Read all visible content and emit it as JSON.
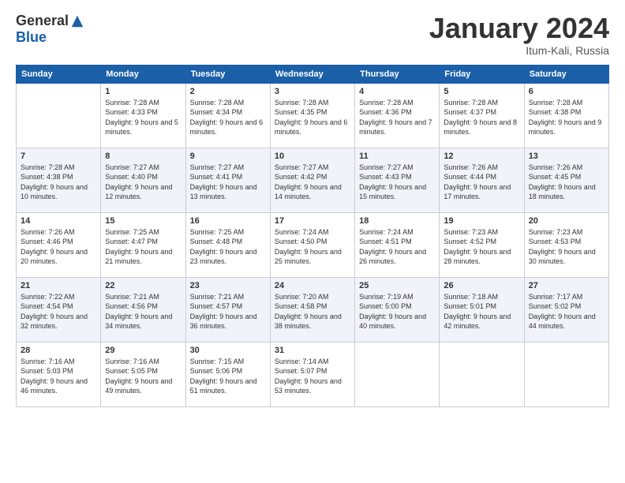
{
  "logo": {
    "general": "General",
    "blue": "Blue"
  },
  "title": "January 2024",
  "location": "Itum-Kali, Russia",
  "days_of_week": [
    "Sunday",
    "Monday",
    "Tuesday",
    "Wednesday",
    "Thursday",
    "Friday",
    "Saturday"
  ],
  "weeks": [
    [
      {
        "day": "",
        "sunrise": "",
        "sunset": "",
        "daylight": ""
      },
      {
        "day": "1",
        "sunrise": "Sunrise: 7:28 AM",
        "sunset": "Sunset: 4:33 PM",
        "daylight": "Daylight: 9 hours and 5 minutes."
      },
      {
        "day": "2",
        "sunrise": "Sunrise: 7:28 AM",
        "sunset": "Sunset: 4:34 PM",
        "daylight": "Daylight: 9 hours and 6 minutes."
      },
      {
        "day": "3",
        "sunrise": "Sunrise: 7:28 AM",
        "sunset": "Sunset: 4:35 PM",
        "daylight": "Daylight: 9 hours and 6 minutes."
      },
      {
        "day": "4",
        "sunrise": "Sunrise: 7:28 AM",
        "sunset": "Sunset: 4:36 PM",
        "daylight": "Daylight: 9 hours and 7 minutes."
      },
      {
        "day": "5",
        "sunrise": "Sunrise: 7:28 AM",
        "sunset": "Sunset: 4:37 PM",
        "daylight": "Daylight: 9 hours and 8 minutes."
      },
      {
        "day": "6",
        "sunrise": "Sunrise: 7:28 AM",
        "sunset": "Sunset: 4:38 PM",
        "daylight": "Daylight: 9 hours and 9 minutes."
      }
    ],
    [
      {
        "day": "7",
        "sunrise": "Sunrise: 7:28 AM",
        "sunset": "Sunset: 4:38 PM",
        "daylight": "Daylight: 9 hours and 10 minutes."
      },
      {
        "day": "8",
        "sunrise": "Sunrise: 7:27 AM",
        "sunset": "Sunset: 4:40 PM",
        "daylight": "Daylight: 9 hours and 12 minutes."
      },
      {
        "day": "9",
        "sunrise": "Sunrise: 7:27 AM",
        "sunset": "Sunset: 4:41 PM",
        "daylight": "Daylight: 9 hours and 13 minutes."
      },
      {
        "day": "10",
        "sunrise": "Sunrise: 7:27 AM",
        "sunset": "Sunset: 4:42 PM",
        "daylight": "Daylight: 9 hours and 14 minutes."
      },
      {
        "day": "11",
        "sunrise": "Sunrise: 7:27 AM",
        "sunset": "Sunset: 4:43 PM",
        "daylight": "Daylight: 9 hours and 15 minutes."
      },
      {
        "day": "12",
        "sunrise": "Sunrise: 7:26 AM",
        "sunset": "Sunset: 4:44 PM",
        "daylight": "Daylight: 9 hours and 17 minutes."
      },
      {
        "day": "13",
        "sunrise": "Sunrise: 7:26 AM",
        "sunset": "Sunset: 4:45 PM",
        "daylight": "Daylight: 9 hours and 18 minutes."
      }
    ],
    [
      {
        "day": "14",
        "sunrise": "Sunrise: 7:26 AM",
        "sunset": "Sunset: 4:46 PM",
        "daylight": "Daylight: 9 hours and 20 minutes."
      },
      {
        "day": "15",
        "sunrise": "Sunrise: 7:25 AM",
        "sunset": "Sunset: 4:47 PM",
        "daylight": "Daylight: 9 hours and 21 minutes."
      },
      {
        "day": "16",
        "sunrise": "Sunrise: 7:25 AM",
        "sunset": "Sunset: 4:48 PM",
        "daylight": "Daylight: 9 hours and 23 minutes."
      },
      {
        "day": "17",
        "sunrise": "Sunrise: 7:24 AM",
        "sunset": "Sunset: 4:50 PM",
        "daylight": "Daylight: 9 hours and 25 minutes."
      },
      {
        "day": "18",
        "sunrise": "Sunrise: 7:24 AM",
        "sunset": "Sunset: 4:51 PM",
        "daylight": "Daylight: 9 hours and 26 minutes."
      },
      {
        "day": "19",
        "sunrise": "Sunrise: 7:23 AM",
        "sunset": "Sunset: 4:52 PM",
        "daylight": "Daylight: 9 hours and 28 minutes."
      },
      {
        "day": "20",
        "sunrise": "Sunrise: 7:23 AM",
        "sunset": "Sunset: 4:53 PM",
        "daylight": "Daylight: 9 hours and 30 minutes."
      }
    ],
    [
      {
        "day": "21",
        "sunrise": "Sunrise: 7:22 AM",
        "sunset": "Sunset: 4:54 PM",
        "daylight": "Daylight: 9 hours and 32 minutes."
      },
      {
        "day": "22",
        "sunrise": "Sunrise: 7:21 AM",
        "sunset": "Sunset: 4:56 PM",
        "daylight": "Daylight: 9 hours and 34 minutes."
      },
      {
        "day": "23",
        "sunrise": "Sunrise: 7:21 AM",
        "sunset": "Sunset: 4:57 PM",
        "daylight": "Daylight: 9 hours and 36 minutes."
      },
      {
        "day": "24",
        "sunrise": "Sunrise: 7:20 AM",
        "sunset": "Sunset: 4:58 PM",
        "daylight": "Daylight: 9 hours and 38 minutes."
      },
      {
        "day": "25",
        "sunrise": "Sunrise: 7:19 AM",
        "sunset": "Sunset: 5:00 PM",
        "daylight": "Daylight: 9 hours and 40 minutes."
      },
      {
        "day": "26",
        "sunrise": "Sunrise: 7:18 AM",
        "sunset": "Sunset: 5:01 PM",
        "daylight": "Daylight: 9 hours and 42 minutes."
      },
      {
        "day": "27",
        "sunrise": "Sunrise: 7:17 AM",
        "sunset": "Sunset: 5:02 PM",
        "daylight": "Daylight: 9 hours and 44 minutes."
      }
    ],
    [
      {
        "day": "28",
        "sunrise": "Sunrise: 7:16 AM",
        "sunset": "Sunset: 5:03 PM",
        "daylight": "Daylight: 9 hours and 46 minutes."
      },
      {
        "day": "29",
        "sunrise": "Sunrise: 7:16 AM",
        "sunset": "Sunset: 5:05 PM",
        "daylight": "Daylight: 9 hours and 49 minutes."
      },
      {
        "day": "30",
        "sunrise": "Sunrise: 7:15 AM",
        "sunset": "Sunset: 5:06 PM",
        "daylight": "Daylight: 9 hours and 51 minutes."
      },
      {
        "day": "31",
        "sunrise": "Sunrise: 7:14 AM",
        "sunset": "Sunset: 5:07 PM",
        "daylight": "Daylight: 9 hours and 53 minutes."
      },
      {
        "day": "",
        "sunrise": "",
        "sunset": "",
        "daylight": ""
      },
      {
        "day": "",
        "sunrise": "",
        "sunset": "",
        "daylight": ""
      },
      {
        "day": "",
        "sunrise": "",
        "sunset": "",
        "daylight": ""
      }
    ]
  ]
}
